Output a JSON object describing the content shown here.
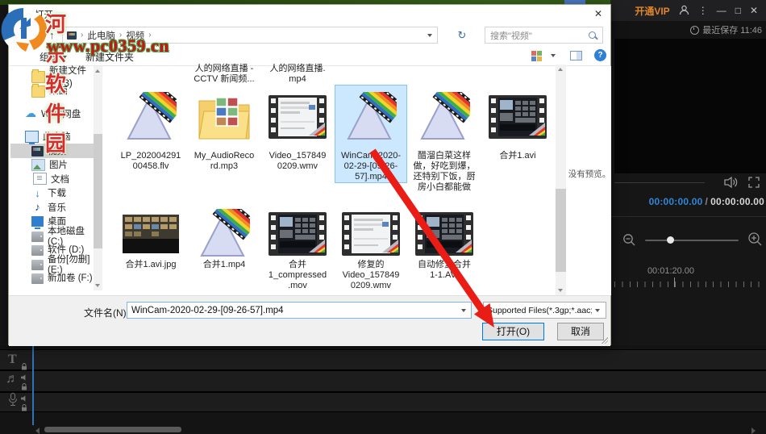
{
  "watermark": {
    "site_name": "河东软件园",
    "site_url": "www.pc0359.cn"
  },
  "app": {
    "titlebar": {
      "vip_label": "开通VIP"
    },
    "saved_status": "最近保存 11:46",
    "player": {
      "current_time": "00:00:00.00",
      "separator": "/",
      "total_time": "00:00:00.00"
    },
    "timeline": {
      "ruler_label": "00:01:20.00"
    }
  },
  "dialog": {
    "title": "打开",
    "breadcrumb": {
      "root": "此电脑",
      "current": "视频"
    },
    "search_placeholder": "搜索\"视频\"",
    "toolbar": {
      "organize": "组织",
      "new_folder": "新建文件夹"
    },
    "sidebar": [
      {
        "label": "新建文件夹 (3)",
        "icon": "folder",
        "level": 2
      },
      {
        "label": "桌面",
        "icon": "folder",
        "level": 2
      },
      {
        "label": "WPS网盘",
        "icon": "cloud",
        "level": 1,
        "gap": true
      },
      {
        "label": "此电脑",
        "icon": "computer",
        "level": 1,
        "gap": true
      },
      {
        "label": "视频",
        "icon": "video",
        "level": 2,
        "selected": true
      },
      {
        "label": "图片",
        "icon": "picture",
        "level": 2
      },
      {
        "label": "文档",
        "icon": "document",
        "level": 2
      },
      {
        "label": "下载",
        "icon": "download",
        "level": 2
      },
      {
        "label": "音乐",
        "icon": "music",
        "level": 2
      },
      {
        "label": "桌面",
        "icon": "desktop",
        "level": 2
      },
      {
        "label": "本地磁盘 (C:)",
        "icon": "drive",
        "level": 2
      },
      {
        "label": "软件 (D:)",
        "icon": "drive",
        "level": 2
      },
      {
        "label": "备份[勿删] (E:)",
        "icon": "drive",
        "level": 2
      },
      {
        "label": "新加卷 (F:)",
        "icon": "drive",
        "level": 2
      }
    ],
    "partial_captions": [
      {
        "col": 1,
        "lines": [
          "人的网络直播 -",
          "CCTV 新闻频..."
        ]
      },
      {
        "col": 2,
        "lines": [
          "人的网络直播.",
          "mp4"
        ]
      }
    ],
    "files_row1": [
      {
        "name_lines": [
          "LP_202004291",
          "00458.flv"
        ],
        "icon": "cone",
        "selected": false
      },
      {
        "name_lines": [
          "My_AudioReco",
          "rd.mp3"
        ],
        "icon": "folder-media",
        "selected": false
      },
      {
        "name_lines": [
          "Video_157849",
          "0209.wmv"
        ],
        "icon": "film-light",
        "selected": false
      },
      {
        "name_lines": [
          "WinCam-2020-",
          "02-29-[09-26-",
          "57].mp4"
        ],
        "icon": "cone",
        "selected": true
      },
      {
        "name_lines": [
          "醋溜白菜这样",
          "做，好吃到爆，",
          "还特别下饭，厨",
          "房小白都能做"
        ],
        "icon": "cone",
        "selected": false
      },
      {
        "name_lines": [
          "合并1.avi"
        ],
        "icon": "film-dark",
        "selected": false
      }
    ],
    "files_row2": [
      {
        "name_lines": [
          "合并1.avi.jpg"
        ],
        "icon": "photo",
        "selected": false
      },
      {
        "name_lines": [
          "合并1.mp4"
        ],
        "icon": "cone",
        "selected": false
      },
      {
        "name_lines": [
          "合并",
          "1_compressed",
          ".mov"
        ],
        "icon": "film-dark",
        "selected": false
      },
      {
        "name_lines": [
          "修复的",
          "Video_157849",
          "0209.wmv"
        ],
        "icon": "film-light",
        "selected": false
      },
      {
        "name_lines": [
          "自动修复合并",
          "1-1.AVI"
        ],
        "icon": "film-dark",
        "selected": false
      }
    ],
    "preview_text": "没有预览。",
    "footer": {
      "filename_label": "文件名(N):",
      "filename_value": "WinCam-2020-02-29-[09-26-57].mp4",
      "filetype_value": "Supported Files(*.3gp;*.aac;*",
      "open_button": "打开(O)",
      "cancel_button": "取消"
    }
  },
  "colors": {
    "selection_blue": "#cce8ff",
    "accent_blue": "#0078d7",
    "vip_orange": "#e0862c",
    "time_blue": "#2f86d6",
    "arrow_red": "#ea1c16",
    "watermark_red": "#d03028"
  }
}
